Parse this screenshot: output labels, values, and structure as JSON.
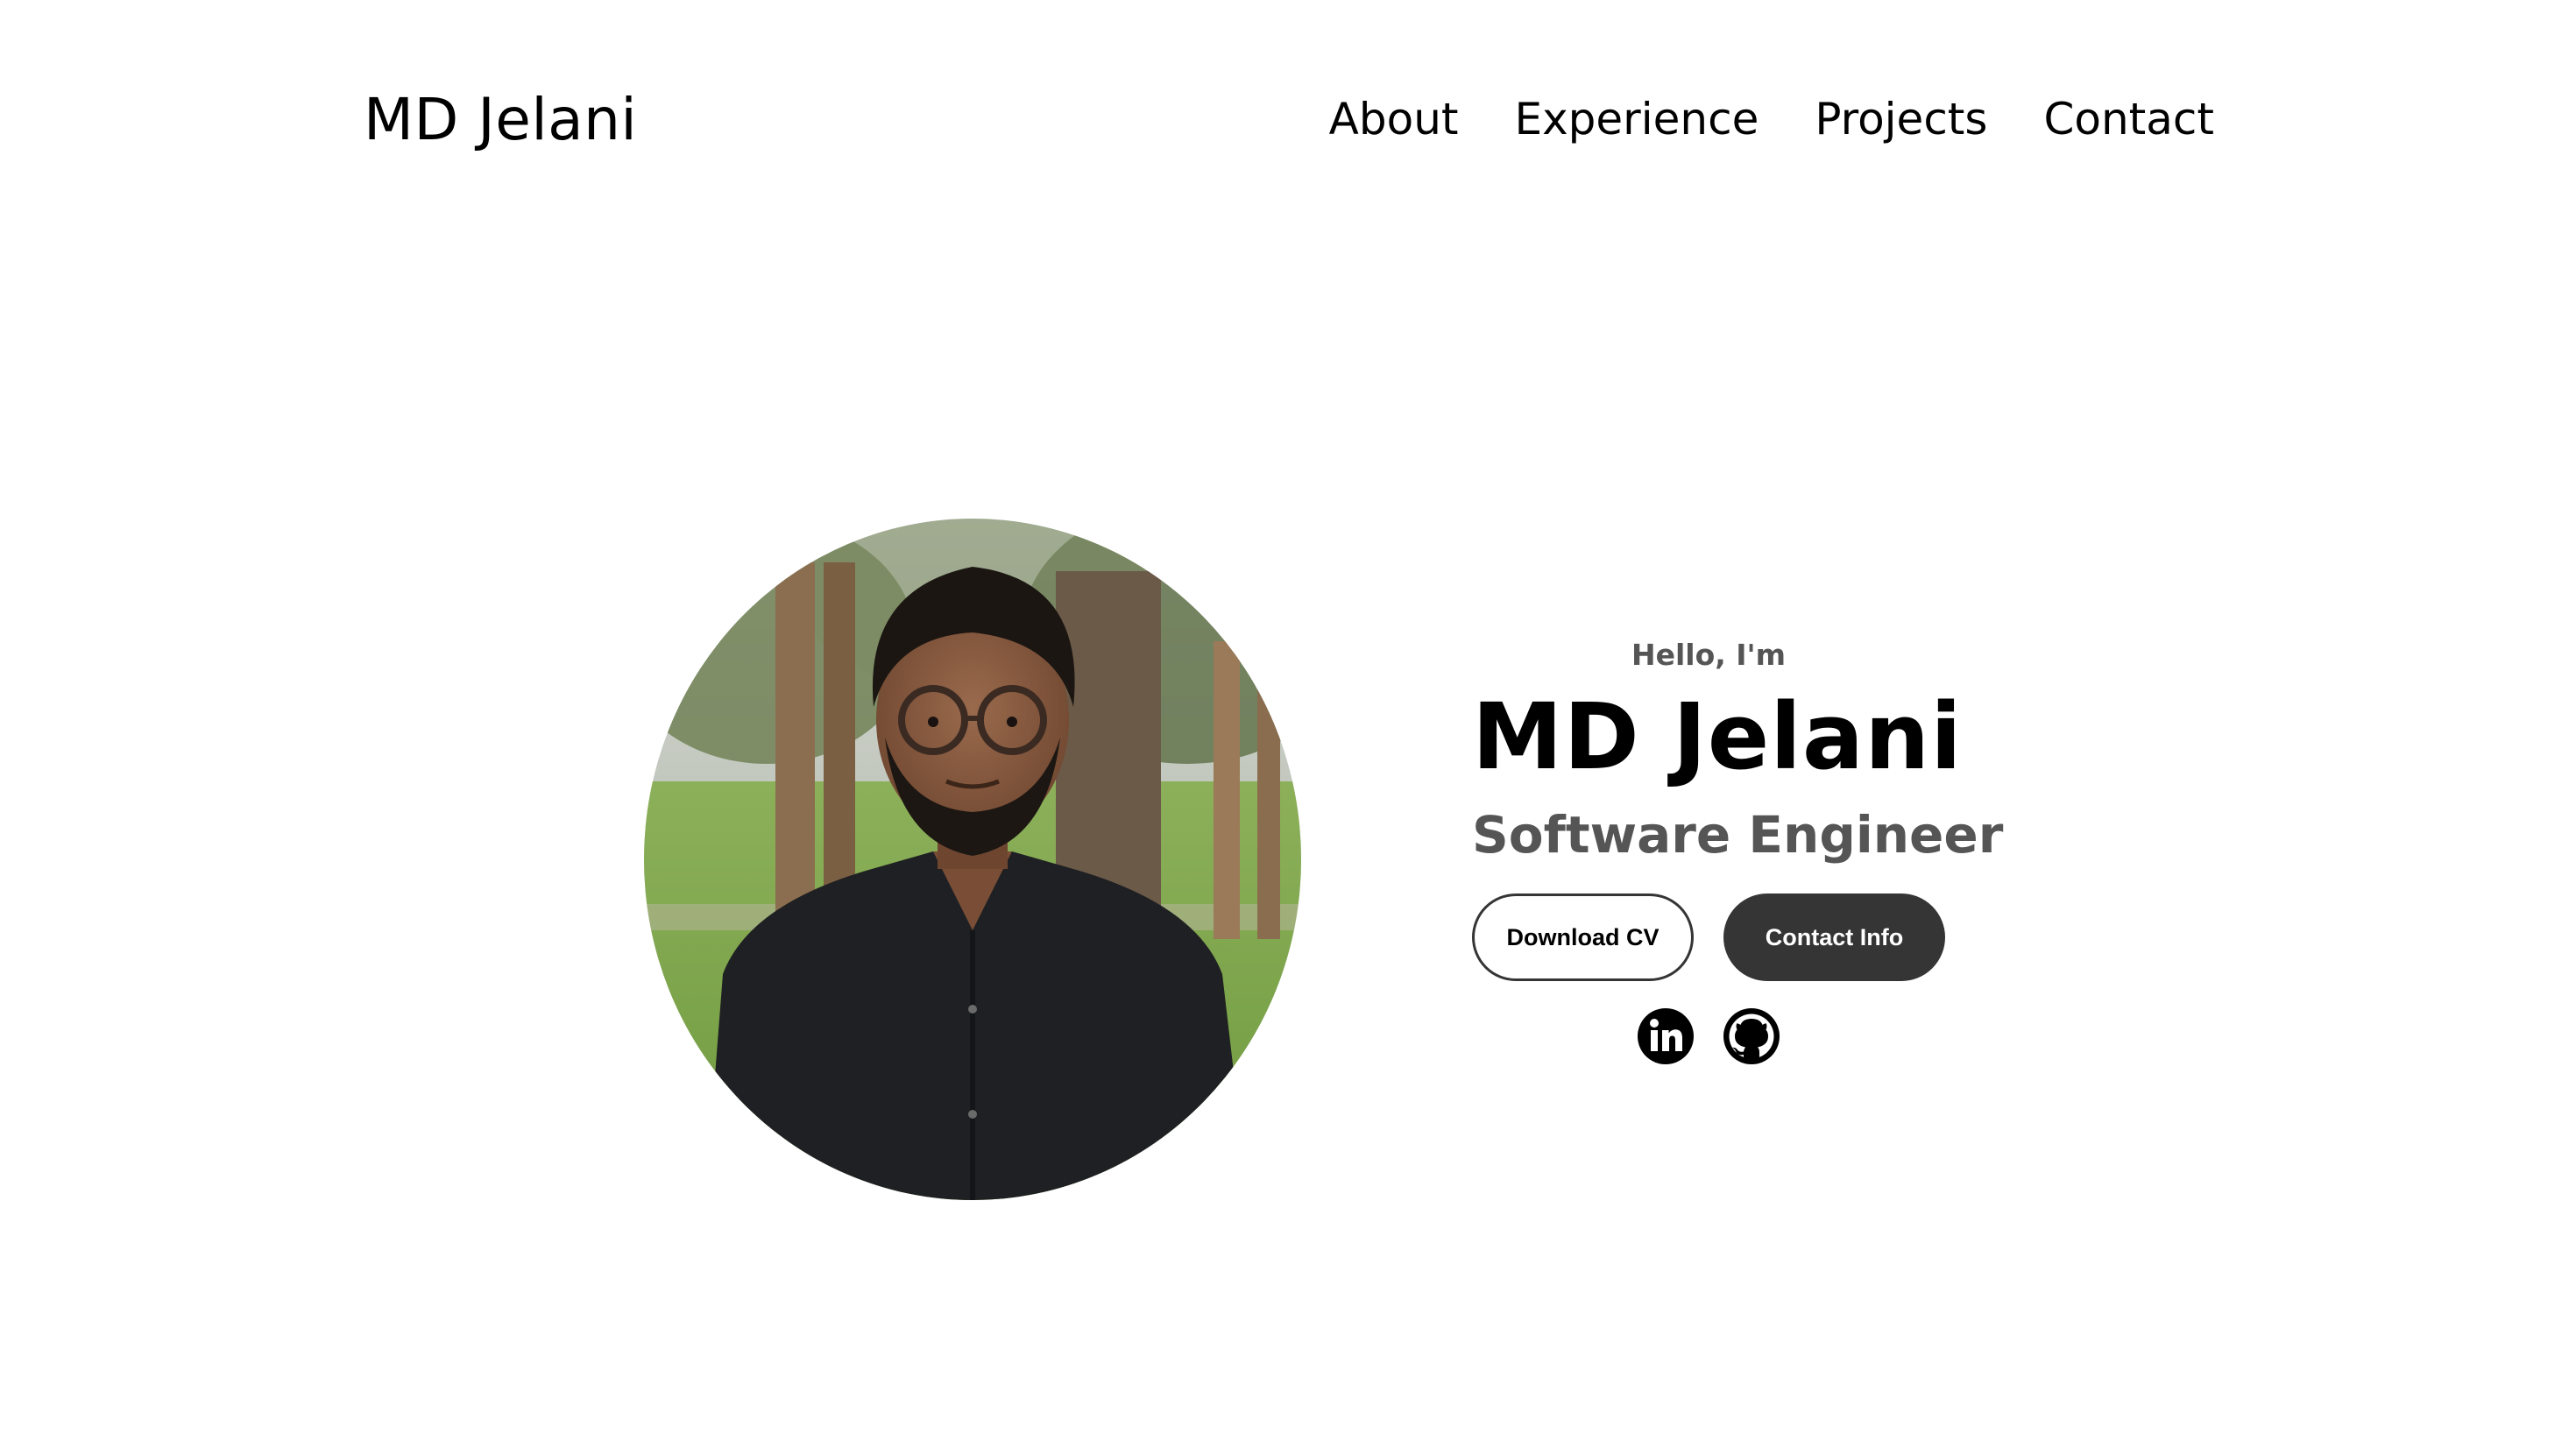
{
  "nav": {
    "logo": "MD Jelani",
    "links": [
      {
        "label": "About"
      },
      {
        "label": "Experience"
      },
      {
        "label": "Projects"
      },
      {
        "label": "Contact"
      }
    ]
  },
  "profile": {
    "greeting": "Hello, I'm",
    "name": "MD Jelani",
    "title": "Software Engineer",
    "buttons": {
      "download_cv": "Download CV",
      "contact_info": "Contact Info"
    },
    "socials": [
      {
        "icon": "linkedin-icon"
      },
      {
        "icon": "github-icon"
      }
    ],
    "photo": {
      "alt": "Profile picture"
    }
  },
  "colors": {
    "text": "#000000",
    "muted_text": "#555555",
    "button_dark": "#353535",
    "background": "#ffffff"
  }
}
